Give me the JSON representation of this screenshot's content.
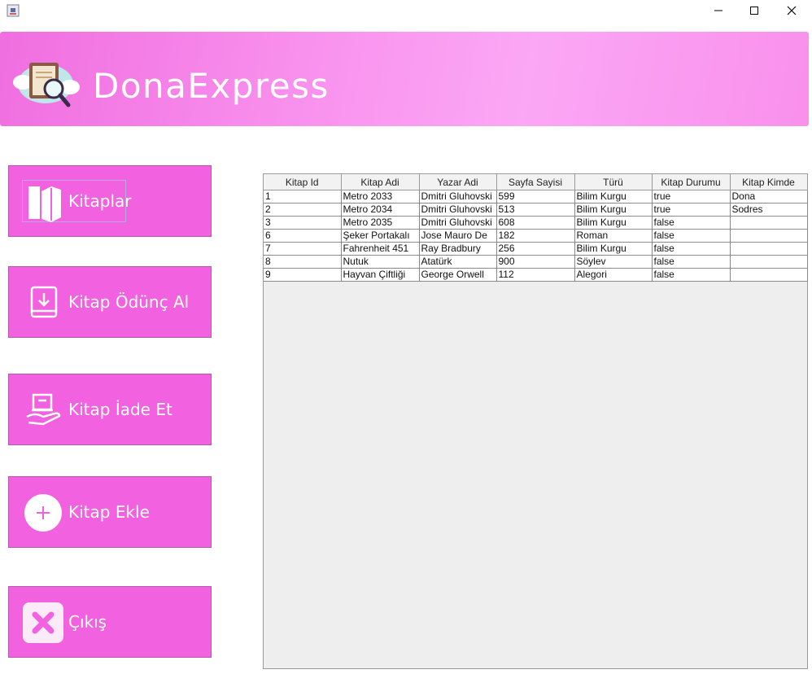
{
  "window": {
    "title": ""
  },
  "header": {
    "app_name": "DonaExpress"
  },
  "sidebar": {
    "buttons": [
      {
        "id": "kitaplar",
        "label": "Kitaplar",
        "icon": "books-icon"
      },
      {
        "id": "odunc",
        "label": "Kitap Ödünç Al",
        "icon": "download-book-icon"
      },
      {
        "id": "iade",
        "label": "Kitap İade Et",
        "icon": "return-book-hand-icon"
      },
      {
        "id": "ekle",
        "label": "Kitap Ekle",
        "icon": "plus-circle-icon"
      },
      {
        "id": "cikis",
        "label": "Çıkış",
        "icon": "close-x-icon"
      }
    ]
  },
  "table": {
    "columns": [
      "Kitap Id",
      "Kitap Adi",
      "Yazar Adi",
      "Sayfa Sayisi",
      "Türü",
      "Kitap Durumu",
      "Kitap Kimde"
    ],
    "rows": [
      [
        "1",
        "Metro 2033",
        "Dmitri Gluhovski",
        "599",
        "Bilim Kurgu",
        "true",
        "Dona"
      ],
      [
        "2",
        "Metro 2034",
        "Dmitri Gluhovski",
        "513",
        "Bilim Kurgu",
        "true",
        "Sodres"
      ],
      [
        "3",
        "Metro 2035",
        "Dmitri Gluhovski",
        "608",
        "Bilim Kurgu",
        "false",
        ""
      ],
      [
        "6",
        "Şeker Portakalı",
        "Jose Mauro De",
        "182",
        "Roman",
        "false",
        ""
      ],
      [
        "7",
        "Fahrenheit 451",
        "Ray Bradbury",
        "256",
        "Bilim Kurgu",
        "false",
        ""
      ],
      [
        "8",
        "Nutuk",
        "Atatürk",
        "900",
        "Söylev",
        "false",
        ""
      ],
      [
        "9",
        "Hayvan Çiftliği",
        "George Orwell",
        "112",
        "Alegori",
        "false",
        ""
      ]
    ]
  },
  "colors": {
    "header": "#f993ee",
    "button": "#f261df",
    "table_bg": "#eeeeee"
  }
}
